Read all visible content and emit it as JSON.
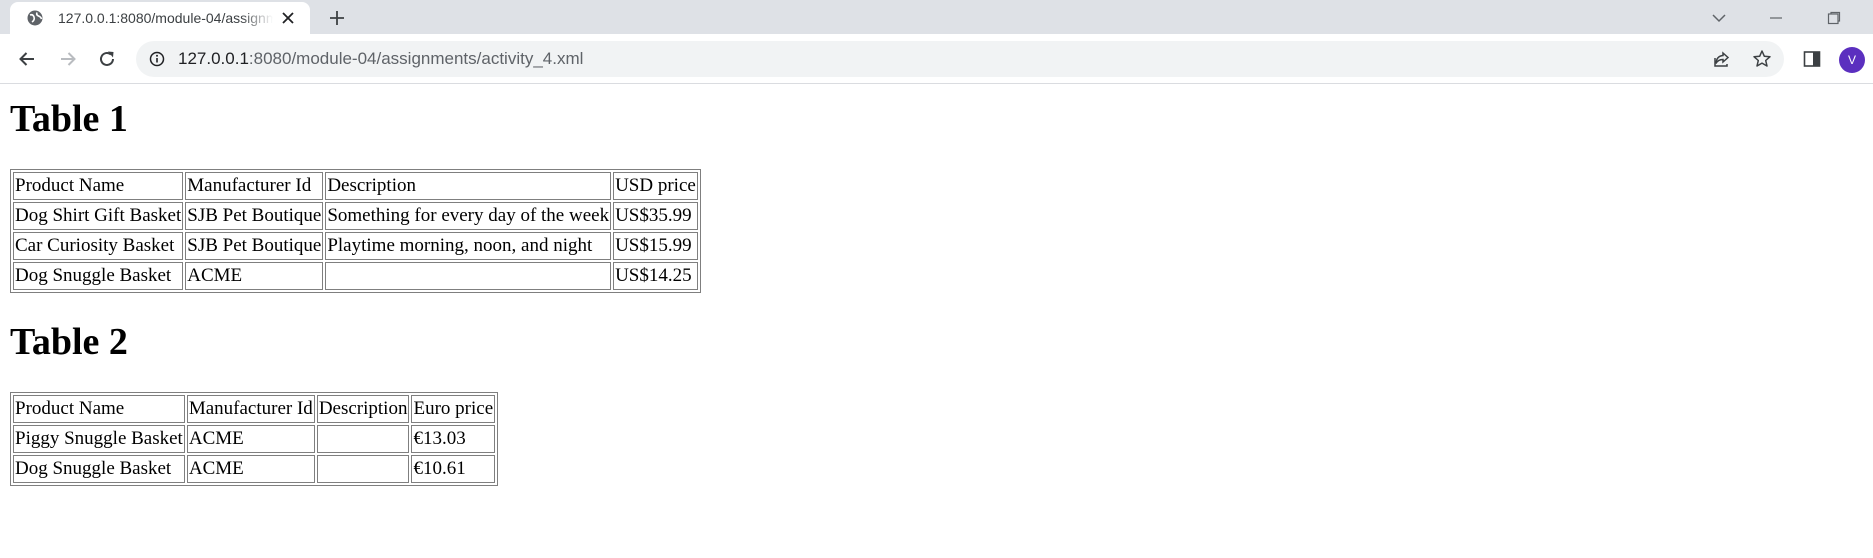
{
  "browser": {
    "tab_title": "127.0.0.1:8080/module-04/assignments/activity_4.xml",
    "url_host": "127.0.0.1",
    "url_rest": ":8080/module-04/assignments/activity_4.xml",
    "profile_initial": "V",
    "profile_color": "#5b2fbf"
  },
  "page": {
    "table1": {
      "heading": "Table 1",
      "headers": [
        "Product Name",
        "Manufacturer Id",
        "Description",
        "USD price"
      ],
      "rows": [
        [
          "Dog Shirt Gift Basket",
          "SJB Pet Boutique",
          "Something for every day of the week",
          "US$35.99"
        ],
        [
          "Car Curiosity Basket",
          "SJB Pet Boutique",
          "Playtime morning, noon, and night",
          "US$15.99"
        ],
        [
          "Dog Snuggle Basket",
          "ACME",
          "",
          "US$14.25"
        ]
      ]
    },
    "table2": {
      "heading": "Table 2",
      "headers": [
        "Product Name",
        "Manufacturer Id",
        "Description",
        "Euro price"
      ],
      "rows": [
        [
          "Piggy Snuggle Basket",
          "ACME",
          "",
          "€13.03"
        ],
        [
          "Dog Snuggle Basket",
          "ACME",
          "",
          "€10.61"
        ]
      ]
    }
  }
}
